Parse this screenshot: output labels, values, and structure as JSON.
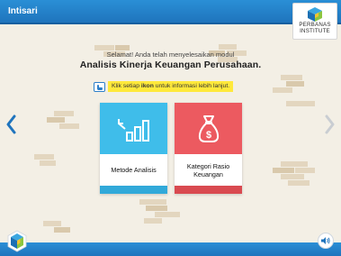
{
  "header": {
    "title": "Intisari"
  },
  "brand": {
    "line1": "PERBANAS",
    "line2": "INSTITUTE"
  },
  "intro": {
    "line1": "Selamat! Anda telah menyelesaikan modul",
    "line2": "Analisis Kinerja Keuangan Perusahaan."
  },
  "hint": {
    "before": "Klik setiap",
    "bold": "ikon",
    "after": "untuk informasi lebih lanjut."
  },
  "cards": [
    {
      "label": "Metode Analisis",
      "icon": "bar-chart-down-icon",
      "color": "#3fbdea"
    },
    {
      "label": "Kategori Rasio Keuangan",
      "icon": "money-bag-icon",
      "color": "#ec5a60"
    }
  ],
  "colors": {
    "topbar": "#1f74bd",
    "hint_bg": "#ffe93b",
    "background": "#f3efe5"
  }
}
